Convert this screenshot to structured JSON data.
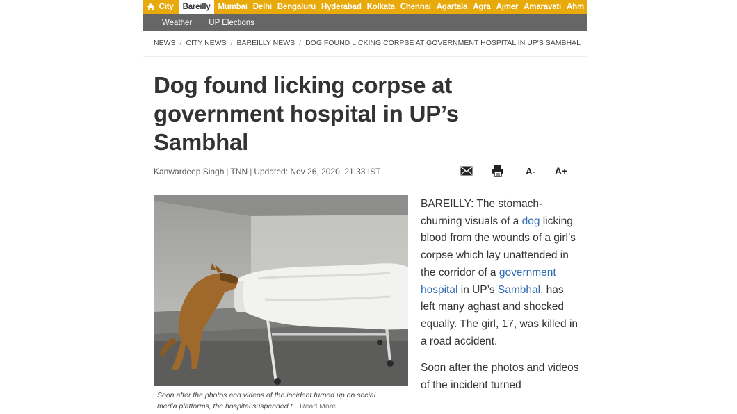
{
  "city_nav": {
    "home_icon": "home-icon",
    "city_label": "City",
    "active_city": "Bareilly",
    "cities": [
      "Mumbai",
      "Delhi",
      "Bengaluru",
      "Hyderabad",
      "Kolkata",
      "Chennai",
      "Agartala",
      "Agra",
      "Ajmer",
      "Amaravati",
      "Ahm"
    ]
  },
  "sub_nav": {
    "items": [
      "Weather",
      "UP Elections"
    ]
  },
  "breadcrumb": {
    "items": [
      "NEWS",
      "CITY NEWS",
      "BAREILLY NEWS",
      "DOG FOUND LICKING CORPSE AT GOVERNMENT HOSPITAL IN UP'S SAMBHAL"
    ],
    "separator": "/"
  },
  "article": {
    "title": "Dog found licking corpse at government hospital in UP’s Sambhal",
    "author": "Kanwardeep Singh",
    "source": "TNN",
    "updated": "Updated: Nov 26, 2020, 21:33 IST",
    "byline_separator": "|",
    "tools": {
      "mail_icon": "mail-icon",
      "print_icon": "print-icon",
      "font_decrease": "A-",
      "font_increase": "A+"
    },
    "image_caption": "Soon after the photos and videos of the incident turned up on social media platforms, the hospital suspended t...",
    "read_more": "Read More",
    "p1": {
      "t1": "BAREILLY: The stomach-churning visuals of a ",
      "l1": "dog",
      "t2": " licking blood from the wounds of a girl’s corpse which lay unattended in the corridor of a ",
      "l2": "government hospital",
      "t3": " in UP’s ",
      "l3": "Sambhal",
      "t4": ", has left many aghast and shocked equally. The girl, 17, was killed in a road accident."
    },
    "p2": "Soon after the photos and videos of the incident turned"
  },
  "colors": {
    "city_bar": "#e8a90a",
    "sub_bar": "#666666",
    "link": "#2f6db5"
  }
}
